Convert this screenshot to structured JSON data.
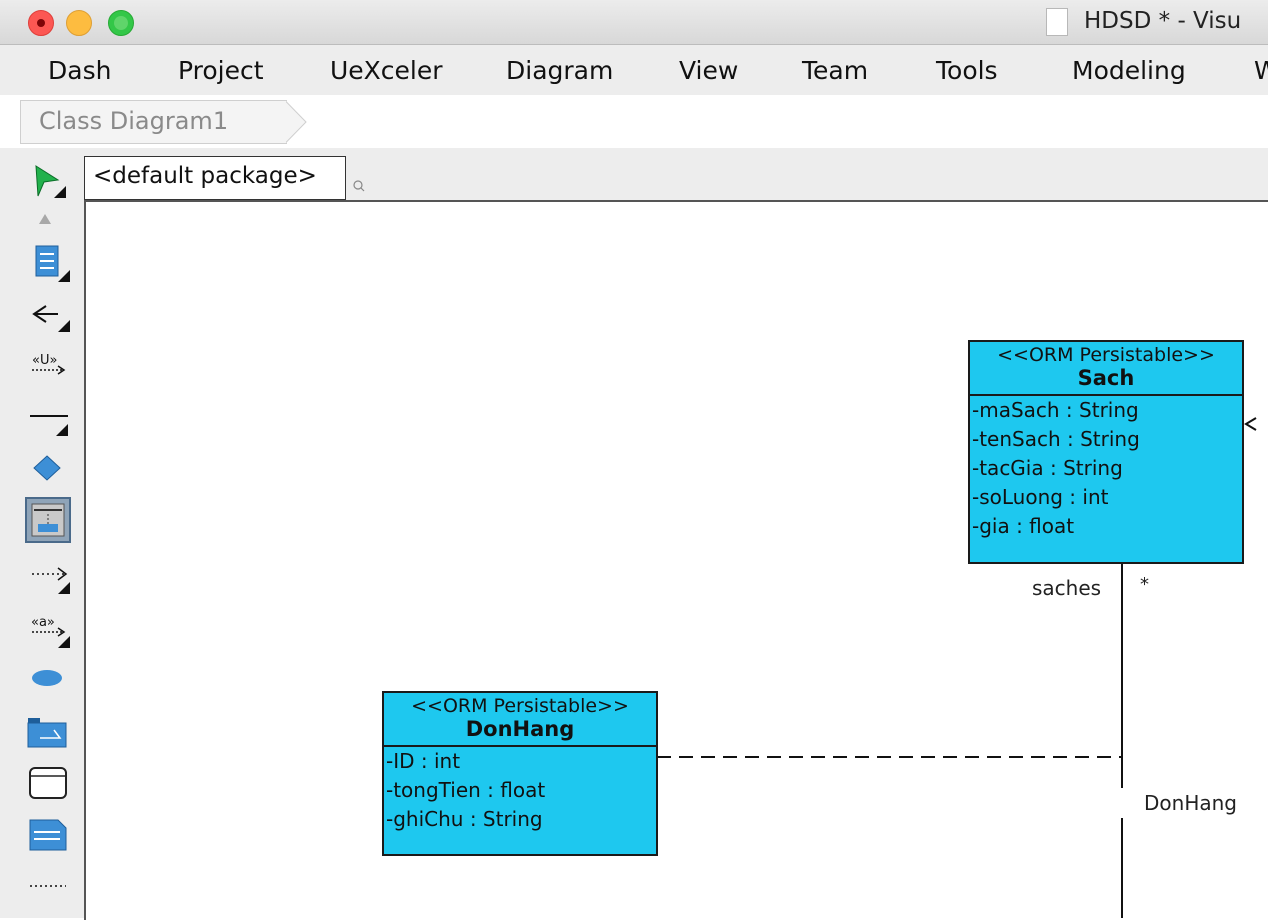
{
  "window": {
    "title": "HDSD * - Visu"
  },
  "menu": {
    "items": [
      "Dash",
      "Project",
      "UeXceler",
      "Diagram",
      "View",
      "Team",
      "Tools",
      "Modeling",
      "W"
    ]
  },
  "breadcrumb": {
    "label": "Class Diagram1"
  },
  "package": {
    "label": "<default package>"
  },
  "toolbar": {
    "tools": [
      "select-arrow-icon",
      "scroll-up-icon",
      "class-icon",
      "generalization-icon",
      "usage-icon",
      "association-icon",
      "diamond-icon",
      "orm-class-icon",
      "dependency-icon",
      "anchor-icon",
      "cloud-icon",
      "package-icon",
      "entity-icon",
      "note-icon",
      "more-icon"
    ]
  },
  "diagram": {
    "classes": [
      {
        "stereotype": "<<ORM Persistable>>",
        "name": "Sach",
        "attributes": [
          "-maSach : String",
          "-tenSach : String",
          "-tacGia : String",
          "-soLuong : int",
          "-gia : float"
        ]
      },
      {
        "stereotype": "<<ORM Persistable>>",
        "name": "DonHang",
        "attributes": [
          "-ID : int",
          "-tongTien : float",
          "-ghiChu : String"
        ]
      }
    ],
    "association": {
      "role_sach": "saches",
      "multiplicity_sach": "*",
      "role_donhang": "DonHang"
    }
  },
  "colors": {
    "class_fill": "#1ec8ef",
    "menubar": "#ededed"
  }
}
